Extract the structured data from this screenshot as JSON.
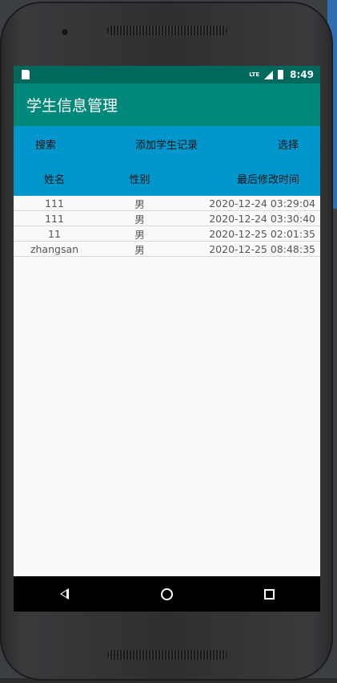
{
  "status_bar": {
    "network": "LTE",
    "time": "8:49"
  },
  "app_bar": {
    "title": "学生信息管理"
  },
  "toolbar": {
    "search_label": "搜索",
    "add_label": "添加学生记录",
    "select_label": "选择"
  },
  "table": {
    "headers": {
      "name": "姓名",
      "gender": "性别",
      "time": "最后修改时间"
    },
    "rows": [
      {
        "name": "111",
        "gender": "男",
        "time": "2020-12-24 03:29:04"
      },
      {
        "name": "111",
        "gender": "男",
        "time": "2020-12-24 03:30:40"
      },
      {
        "name": "11",
        "gender": "男",
        "time": "2020-12-25 02:01:35"
      },
      {
        "name": "zhangsan",
        "gender": "男",
        "time": "2020-12-25 08:48:35"
      }
    ]
  },
  "colors": {
    "status_bar": "#00695c",
    "app_bar": "#00897b",
    "toolbar": "#0197cd",
    "nav_bar": "#000000"
  },
  "icons": {
    "sd_card": "sd-card-icon",
    "signal": "signal-icon",
    "battery": "battery-charging-icon",
    "back": "back-icon",
    "home": "home-icon",
    "recents": "recents-icon"
  }
}
